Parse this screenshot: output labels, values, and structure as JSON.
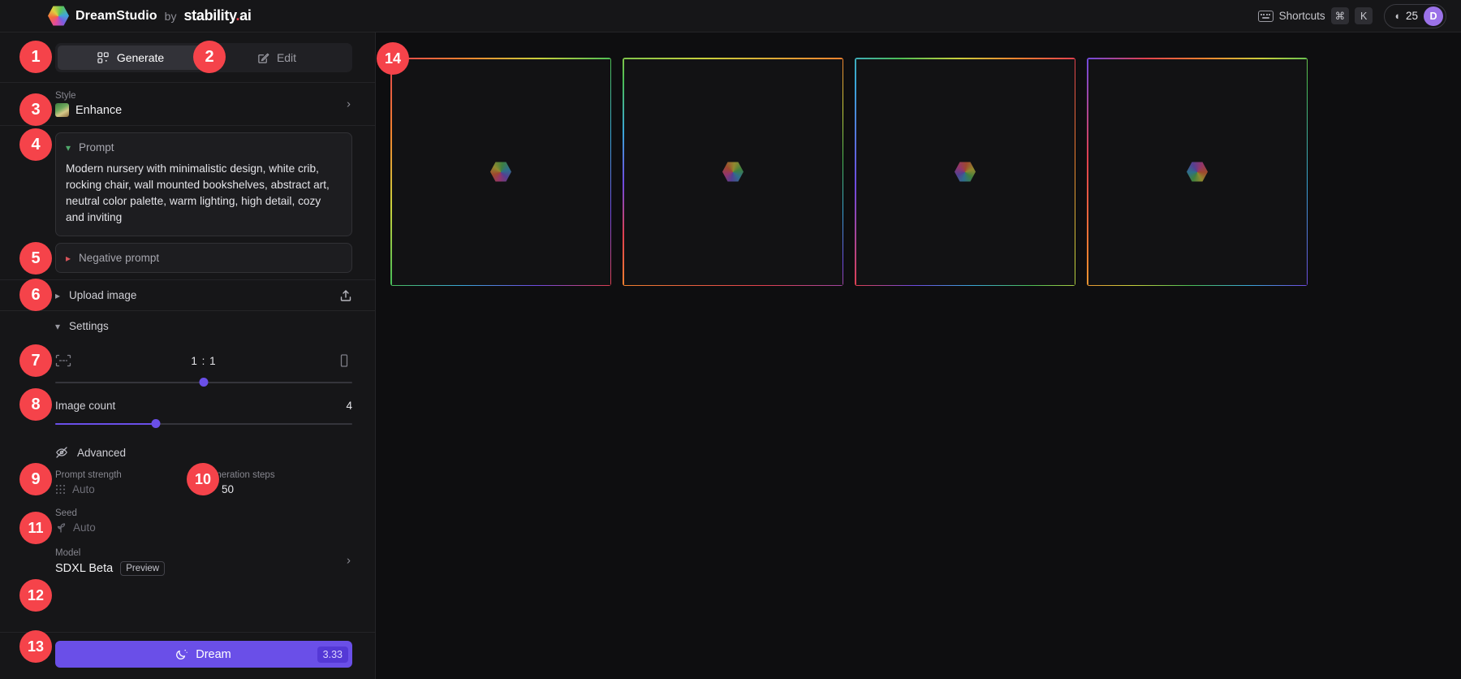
{
  "header": {
    "brand_name": "DreamStudio",
    "brand_by": "by",
    "brand_stability": "stability",
    "brand_dot": ".",
    "brand_ai": "ai",
    "shortcuts_label": "Shortcuts",
    "key_cmd": "⌘",
    "key_k": "K",
    "credits": "25",
    "avatar_initial": "D"
  },
  "tabs": {
    "generate": "Generate",
    "edit": "Edit"
  },
  "style": {
    "label": "Style",
    "value": "Enhance"
  },
  "prompt": {
    "title": "Prompt",
    "text": "Modern nursery with minimalistic design, white crib, rocking chair, wall mounted bookshelves, abstract art, neutral color palette, warm lighting, high detail, cozy and inviting"
  },
  "negative_prompt": {
    "title": "Negative prompt"
  },
  "upload_image": {
    "title": "Upload image"
  },
  "settings": {
    "title": "Settings",
    "aspect_ratio": "1 : 1",
    "image_count_label": "Image count",
    "image_count_value": "4"
  },
  "advanced": {
    "title": "Advanced",
    "prompt_strength_label": "Prompt strength",
    "prompt_strength_value": "Auto",
    "generation_steps_label": "Generation steps",
    "generation_steps_value": "50",
    "seed_label": "Seed",
    "seed_value": "Auto"
  },
  "model": {
    "label": "Model",
    "value": "SDXL Beta",
    "badge": "Preview"
  },
  "dream": {
    "label": "Dream",
    "cost": "3.33"
  },
  "colors": {
    "accent_purple": "#6a4fe8",
    "annotation_red": "#f5434a",
    "panel_bg": "#161618",
    "canvas_bg": "#0e0e10"
  },
  "annotations": [
    {
      "n": "1"
    },
    {
      "n": "2"
    },
    {
      "n": "3"
    },
    {
      "n": "4"
    },
    {
      "n": "5"
    },
    {
      "n": "6"
    },
    {
      "n": "7"
    },
    {
      "n": "8"
    },
    {
      "n": "9"
    },
    {
      "n": "10"
    },
    {
      "n": "11"
    },
    {
      "n": "12"
    },
    {
      "n": "13"
    },
    {
      "n": "14"
    }
  ]
}
